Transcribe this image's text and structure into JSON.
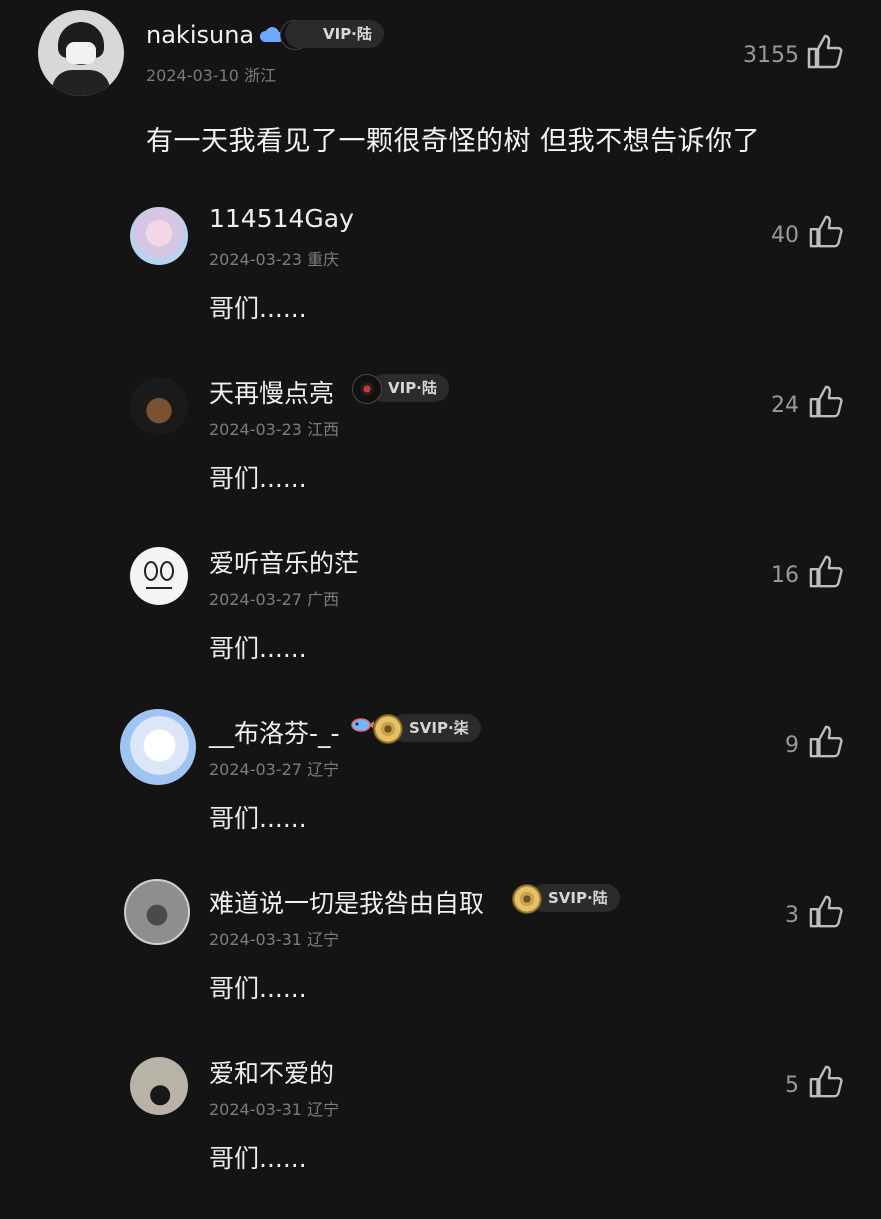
{
  "main_comment": {
    "username": "nakisuna",
    "badge": "VIP·陆",
    "date": "2024-03-10",
    "location": "浙江",
    "likes": "3155",
    "text": "有一天我看见了一颗很奇怪的树 但我不想告诉你了",
    "icons": {
      "cloud": "cloud-icon",
      "record": "record-icon",
      "like": "thumbs-up-icon"
    }
  },
  "replies": [
    {
      "username": "114514Gay",
      "date": "2024-03-23",
      "location": "重庆",
      "likes": "40",
      "text": "哥们......",
      "badge": ""
    },
    {
      "username": "天再慢点亮",
      "date": "2024-03-23",
      "location": "江西",
      "likes": "24",
      "text": "哥们......",
      "badge": "VIP·陆"
    },
    {
      "username": "爱听音乐的茫",
      "date": "2024-03-27",
      "location": "广西",
      "likes": "16",
      "text": "哥们......",
      "badge": ""
    },
    {
      "username": "__布洛芬-_-",
      "date": "2024-03-27",
      "location": "辽宁",
      "likes": "9",
      "text": "哥们......",
      "badge": "SVIP·柒"
    },
    {
      "username": "难道说一切是我咎由自取",
      "date": "2024-03-31",
      "location": "辽宁",
      "likes": "3",
      "text": "哥们......",
      "badge": "SVIP·陆"
    },
    {
      "username": "爱和不爱的",
      "date": "2024-03-31",
      "location": "辽宁",
      "likes": "5",
      "text": "哥们......",
      "badge": ""
    }
  ],
  "colors": {
    "background": "#141414",
    "primary_text": "#f0f0f0",
    "secondary_text": "#7d7d7d",
    "like_count": "#9a9a9a",
    "vip_red": "#cc3333",
    "svip_gold": "#c9a24c"
  }
}
